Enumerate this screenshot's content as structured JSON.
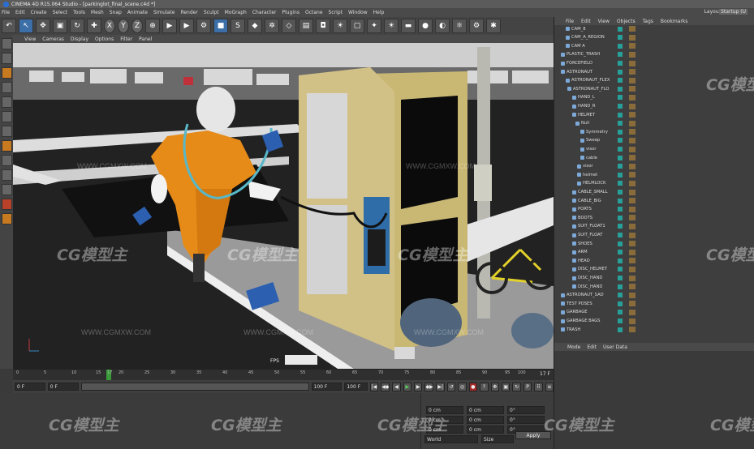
{
  "window": {
    "title": "CINEMA 4D R15.064 Studio - [parkinglot_final_scene.c4d *]"
  },
  "menu": [
    "File",
    "Edit",
    "Create",
    "Select",
    "Tools",
    "Mesh",
    "Snap",
    "Animate",
    "Simulate",
    "Render",
    "Sculpt",
    "MoGraph",
    "Character",
    "Plugins",
    "Octane",
    "Script",
    "Window",
    "Help"
  ],
  "layout": {
    "label": "Layout:",
    "value": "Startup (U"
  },
  "viewport_menu": [
    "View",
    "Cameras",
    "Display",
    "Options",
    "Filter",
    "Panel"
  ],
  "object_manager": {
    "tabs": [
      "File",
      "Edit",
      "View",
      "Objects",
      "Tags",
      "Bookmarks"
    ],
    "objects": [
      "CAM_8",
      "CAM_A_REGION",
      "CAM A",
      "PLASTIC_TRASH",
      "FORCEFIELD",
      "ASTRONAUT",
      "ASTRONAUT_FLEX",
      "ASTRONAUT_FLO",
      "HAND_L",
      "HAND_R",
      "HELMET",
      "Null",
      "Symmetry",
      "Sweep",
      "visor",
      "cable",
      "visor",
      "helmet",
      "HELMLOCK",
      "CABLE_SMALL",
      "CABLE_BIG",
      "PORTS",
      "BOOTS",
      "SUIT_FLOAT1",
      "SUIT_FLOAT",
      "SHOES",
      "ARM",
      "HEAD",
      "DISC_HELMET",
      "DISC_HAND",
      "DISC_HAND",
      "ASTRONAUT_SAD",
      "TEST POSES",
      "GARBAGE",
      "GARBAGE BAGS",
      "TRASH"
    ]
  },
  "attribute_manager": {
    "tabs": [
      "Mode",
      "Edit",
      "User Data"
    ]
  },
  "timeline": {
    "ticks": [
      "0",
      "5",
      "10",
      "15",
      "17",
      "20",
      "25",
      "30",
      "35",
      "40",
      "45",
      "50",
      "55",
      "60",
      "65",
      "70",
      "75",
      "80",
      "85",
      "90",
      "95",
      "100"
    ],
    "current_frame": "17 F",
    "end_frame": "17"
  },
  "transport": {
    "start": "0 F",
    "current": "0 F",
    "end": "100 F",
    "end2": "100 F"
  },
  "coordinates": {
    "rows": [
      {
        "a": "0 cm",
        "b": "0 cm",
        "c": "0°"
      },
      {
        "a": "0 cm",
        "b": "0 cm",
        "c": "0°"
      },
      {
        "a": "0 cm",
        "b": "0 cm",
        "c": "0°"
      }
    ],
    "mode": "World",
    "scale": "Size",
    "apply": "Apply"
  },
  "viewport_overlay": {
    "fps": "FPS"
  },
  "watermarks": {
    "brand": "CG模型主",
    "url": "WWW.CGMXW.COM"
  },
  "colors": {
    "accent": "#3c6fa8",
    "timeline_cursor": "#3a9a3a",
    "swatch": "#28a09a"
  }
}
